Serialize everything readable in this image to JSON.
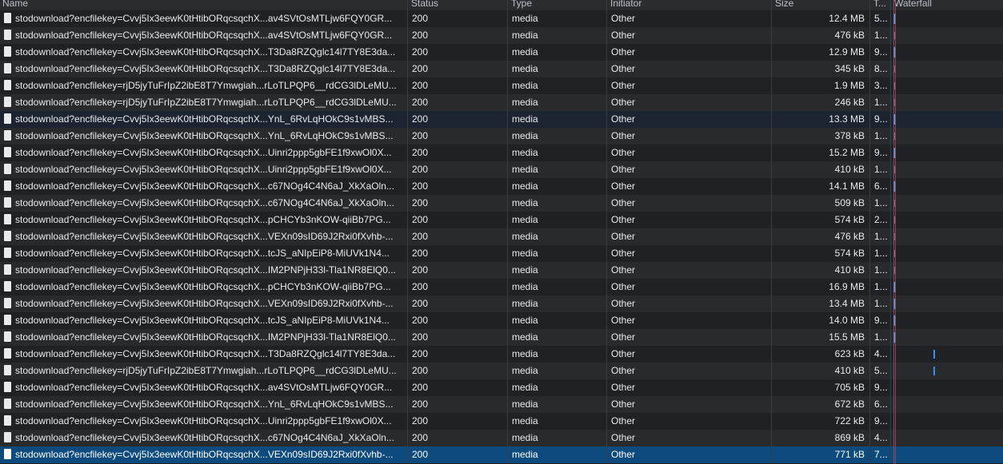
{
  "header": {
    "name": "Name",
    "status": "Status",
    "type": "Type",
    "initiator": "Initiator",
    "size": "Size",
    "time": "T...",
    "waterfall": "Waterfall"
  },
  "colors": {
    "background": "#202124",
    "row_alt": "#292a2d",
    "selected_row": "#0d4a7d",
    "waterfall_bar": "#4d9ff1",
    "red_marker": "#d93025",
    "blue_marker": "#4d9ff1"
  },
  "rows": [
    {
      "name": "stodownload?encfilekey=Cvvj5Ix3eewK0tHtibORqcsqchX...av4SVtOsMTLjw6FQY0GR...",
      "status": "200",
      "type": "media",
      "initiator": "Other",
      "size": "12.4 MB",
      "time": "5...",
      "bar": "long"
    },
    {
      "name": "stodownload?encfilekey=Cvvj5Ix3eewK0tHtibORqcsqchX...av4SVtOsMTLjw6FQY0GR...",
      "status": "200",
      "type": "media",
      "initiator": "Other",
      "size": "476 kB",
      "time": "1...",
      "bar": "short"
    },
    {
      "name": "stodownload?encfilekey=Cvvj5Ix3eewK0tHtibORqcsqchX...T3Da8RZQglc14l7TY8E3da...",
      "status": "200",
      "type": "media",
      "initiator": "Other",
      "size": "12.9 MB",
      "time": "9...",
      "bar": "long"
    },
    {
      "name": "stodownload?encfilekey=Cvvj5Ix3eewK0tHtibORqcsqchX...T3Da8RZQglc14l7TY8E3da...",
      "status": "200",
      "type": "media",
      "initiator": "Other",
      "size": "345 kB",
      "time": "8...",
      "bar": "short"
    },
    {
      "name": "stodownload?encfilekey=rjD5jyTuFrIpZ2ibE8T7Ymwgiah...rLoTLPQP6__rdCG3lDLeMU...",
      "status": "200",
      "type": "media",
      "initiator": "Other",
      "size": "1.9 MB",
      "time": "3...",
      "bar": "short"
    },
    {
      "name": "stodownload?encfilekey=rjD5jyTuFrIpZ2ibE8T7Ymwgiah...rLoTLPQP6__rdCG3lDLeMU...",
      "status": "200",
      "type": "media",
      "initiator": "Other",
      "size": "246 kB",
      "time": "1...",
      "bar": "short"
    },
    {
      "name": "stodownload?encfilekey=Cvvj5Ix3eewK0tHtibORqcsqchX...YnL_6RvLqHOkC9s1vMBS...",
      "status": "200",
      "type": "media",
      "initiator": "Other",
      "size": "13.3 MB",
      "time": "9...",
      "bar": "long",
      "highlight": true
    },
    {
      "name": "stodownload?encfilekey=Cvvj5Ix3eewK0tHtibORqcsqchX...YnL_6RvLqHOkC9s1vMBS...",
      "status": "200",
      "type": "media",
      "initiator": "Other",
      "size": "378 kB",
      "time": "1...",
      "bar": "short"
    },
    {
      "name": "stodownload?encfilekey=Cvvj5Ix3eewK0tHtibORqcsqchX...Uinri2ppp5gbFE1f9xwOl0X...",
      "status": "200",
      "type": "media",
      "initiator": "Other",
      "size": "15.2 MB",
      "time": "9...",
      "bar": "long"
    },
    {
      "name": "stodownload?encfilekey=Cvvj5Ix3eewK0tHtibORqcsqchX...Uinri2ppp5gbFE1f9xwOl0X...",
      "status": "200",
      "type": "media",
      "initiator": "Other",
      "size": "410 kB",
      "time": "1...",
      "bar": "short"
    },
    {
      "name": "stodownload?encfilekey=Cvvj5Ix3eewK0tHtibORqcsqchX...c67NOg4C4N6aJ_XkXaOln...",
      "status": "200",
      "type": "media",
      "initiator": "Other",
      "size": "14.1 MB",
      "time": "6...",
      "bar": "long"
    },
    {
      "name": "stodownload?encfilekey=Cvvj5Ix3eewK0tHtibORqcsqchX...c67NOg4C4N6aJ_XkXaOln...",
      "status": "200",
      "type": "media",
      "initiator": "Other",
      "size": "509 kB",
      "time": "1...",
      "bar": "short"
    },
    {
      "name": "stodownload?encfilekey=Cvvj5Ix3eewK0tHtibORqcsqchX...pCHCYb3nKOW-qiiBb7PG...",
      "status": "200",
      "type": "media",
      "initiator": "Other",
      "size": "574 kB",
      "time": "2...",
      "bar": "short"
    },
    {
      "name": "stodownload?encfilekey=Cvvj5Ix3eewK0tHtibORqcsqchX...VEXn09sID69J2Rxi0fXvhb-...",
      "status": "200",
      "type": "media",
      "initiator": "Other",
      "size": "476 kB",
      "time": "1...",
      "bar": "short"
    },
    {
      "name": "stodownload?encfilekey=Cvvj5Ix3eewK0tHtibORqcsqchX...tcJS_aNIpEiP8-MiUVk1N4...",
      "status": "200",
      "type": "media",
      "initiator": "Other",
      "size": "574 kB",
      "time": "1...",
      "bar": "short"
    },
    {
      "name": "stodownload?encfilekey=Cvvj5Ix3eewK0tHtibORqcsqchX...IM2PNPjH33l-Tla1NR8ElQ0...",
      "status": "200",
      "type": "media",
      "initiator": "Other",
      "size": "410 kB",
      "time": "1...",
      "bar": "short"
    },
    {
      "name": "stodownload?encfilekey=Cvvj5Ix3eewK0tHtibORqcsqchX...pCHCYb3nKOW-qiiBb7PG...",
      "status": "200",
      "type": "media",
      "initiator": "Other",
      "size": "16.9 MB",
      "time": "1...",
      "bar": "long"
    },
    {
      "name": "stodownload?encfilekey=Cvvj5Ix3eewK0tHtibORqcsqchX...VEXn09sID69J2Rxi0fXvhb-...",
      "status": "200",
      "type": "media",
      "initiator": "Other",
      "size": "13.4 MB",
      "time": "1...",
      "bar": "long"
    },
    {
      "name": "stodownload?encfilekey=Cvvj5Ix3eewK0tHtibORqcsqchX...tcJS_aNIpEiP8-MiUVk1N4...",
      "status": "200",
      "type": "media",
      "initiator": "Other",
      "size": "14.0 MB",
      "time": "9...",
      "bar": "long"
    },
    {
      "name": "stodownload?encfilekey=Cvvj5Ix3eewK0tHtibORqcsqchX...IM2PNPjH33l-Tla1NR8ElQ0...",
      "status": "200",
      "type": "media",
      "initiator": "Other",
      "size": "15.5 MB",
      "time": "1...",
      "bar": "long"
    },
    {
      "name": "stodownload?encfilekey=Cvvj5Ix3eewK0tHtibORqcsqchX...T3Da8RZQglc14l7TY8E3da...",
      "status": "200",
      "type": "media",
      "initiator": "Other",
      "size": "623 kB",
      "time": "4...",
      "bar": "late"
    },
    {
      "name": "stodownload?encfilekey=rjD5jyTuFrIpZ2ibE8T7Ymwgiah...rLoTLPQP6__rdCG3lDLeMU...",
      "status": "200",
      "type": "media",
      "initiator": "Other",
      "size": "410 kB",
      "time": "5...",
      "bar": "late"
    },
    {
      "name": "stodownload?encfilekey=Cvvj5Ix3eewK0tHtibORqcsqchX...av4SVtOsMTLjw6FQY0GR...",
      "status": "200",
      "type": "media",
      "initiator": "Other",
      "size": "705 kB",
      "time": "9...",
      "bar": "none"
    },
    {
      "name": "stodownload?encfilekey=Cvvj5Ix3eewK0tHtibORqcsqchX...YnL_6RvLqHOkC9s1vMBS...",
      "status": "200",
      "type": "media",
      "initiator": "Other",
      "size": "672 kB",
      "time": "6...",
      "bar": "none"
    },
    {
      "name": "stodownload?encfilekey=Cvvj5Ix3eewK0tHtibORqcsqchX...Uinri2ppp5gbFE1f9xwOl0X...",
      "status": "200",
      "type": "media",
      "initiator": "Other",
      "size": "722 kB",
      "time": "9...",
      "bar": "none"
    },
    {
      "name": "stodownload?encfilekey=Cvvj5Ix3eewK0tHtibORqcsqchX...c67NOg4C4N6aJ_XkXaOln...",
      "status": "200",
      "type": "media",
      "initiator": "Other",
      "size": "869 kB",
      "time": "4...",
      "bar": "none"
    },
    {
      "name": "stodownload?encfilekey=Cvvj5Ix3eewK0tHtibORqcsqchX...VEXn09sID69J2Rxi0fXvhb-...",
      "status": "200",
      "type": "media",
      "initiator": "Other",
      "size": "771 kB",
      "time": "7...",
      "bar": "none",
      "selected": true
    }
  ]
}
